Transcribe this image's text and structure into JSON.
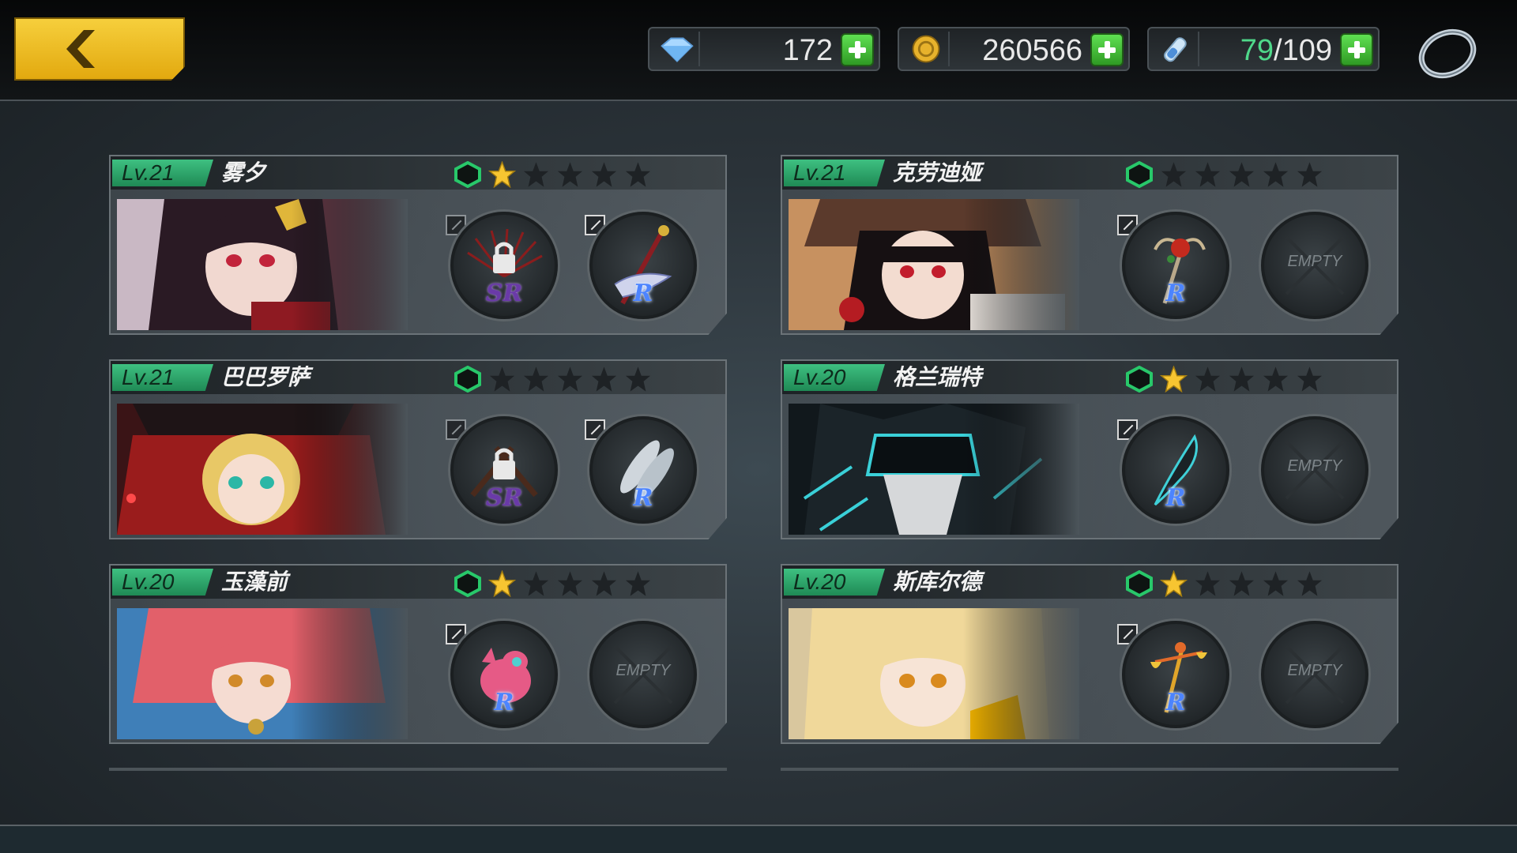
{
  "topbar": {
    "gems": "172",
    "gold": "260566",
    "stamina_current": "79",
    "stamina_max": "/109"
  },
  "colors": {
    "accent_yellow": "#f3c431",
    "level_green": "#32b673",
    "plus_green": "#48c43b",
    "star_gold": "#f7c531"
  },
  "empty_label": "EMPTY",
  "characters": [
    {
      "level": "Lv.21",
      "name": "雾夕",
      "stars": 1,
      "slot1": {
        "type": "locked",
        "rarity": "SR"
      },
      "slot2": {
        "rarity": "R",
        "item": "staff-with-ribbon-icon"
      }
    },
    {
      "level": "Lv.21",
      "name": "克劳迪娅",
      "stars": 0,
      "slot1": {
        "rarity": "R",
        "item": "rose-scepter-icon"
      },
      "slot2": {
        "type": "empty"
      }
    },
    {
      "level": "Lv.21",
      "name": "巴巴罗萨",
      "stars": 0,
      "slot1": {
        "type": "locked",
        "rarity": "SR"
      },
      "slot2": {
        "rarity": "R",
        "item": "fish-icon"
      }
    },
    {
      "level": "Lv.20",
      "name": "格兰瑞特",
      "stars": 1,
      "slot1": {
        "rarity": "R",
        "item": "dark-blade-icon"
      },
      "slot2": {
        "type": "empty"
      }
    },
    {
      "level": "Lv.20",
      "name": "玉藻前",
      "stars": 1,
      "slot1": {
        "rarity": "R",
        "item": "pink-creature-icon"
      },
      "slot2": {
        "type": "empty"
      }
    },
    {
      "level": "Lv.20",
      "name": "斯库尔德",
      "stars": 1,
      "slot1": {
        "rarity": "R",
        "item": "scales-staff-icon"
      },
      "slot2": {
        "type": "empty"
      }
    }
  ]
}
